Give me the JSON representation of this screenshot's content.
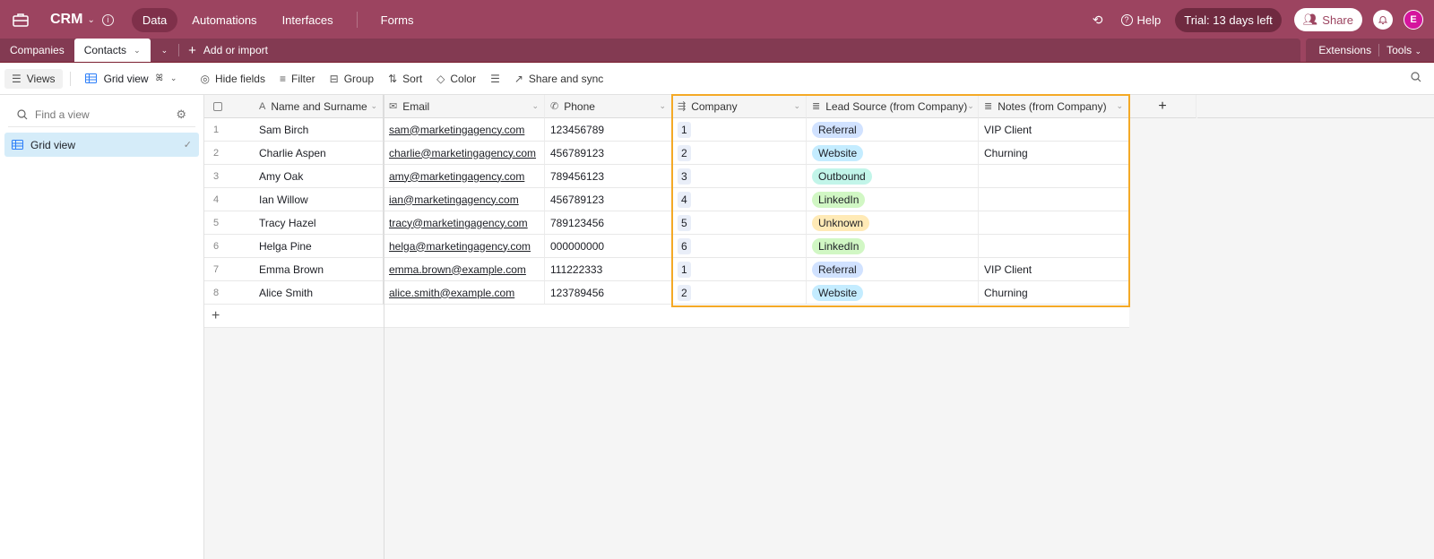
{
  "app": {
    "base_name": "CRM",
    "nav": [
      {
        "label": "Data",
        "active": true
      },
      {
        "label": "Automations",
        "active": false
      },
      {
        "label": "Interfaces",
        "active": false
      },
      {
        "label": "Forms",
        "active": false
      }
    ],
    "help_label": "Help",
    "trial_label": "Trial: 13 days left",
    "share_label": "Share",
    "avatar_initial": "E",
    "brand_color": "#9c4460"
  },
  "tables": {
    "tabs": [
      {
        "label": "Companies",
        "active": false
      },
      {
        "label": "Contacts",
        "active": true
      }
    ],
    "add_import_label": "Add or import",
    "extensions_label": "Extensions",
    "tools_label": "Tools"
  },
  "toolbar": {
    "views_label": "Views",
    "current_view": "Grid view",
    "hide_fields": "Hide fields",
    "filter": "Filter",
    "group": "Group",
    "sort": "Sort",
    "color": "Color",
    "share_sync": "Share and sync"
  },
  "sidebar": {
    "find_placeholder": "Find a view",
    "views": [
      {
        "label": "Grid view",
        "selected": true
      }
    ]
  },
  "grid": {
    "columns": [
      {
        "label": "Name and Surname",
        "icon": "text-icon"
      },
      {
        "label": "Email",
        "icon": "email-icon"
      },
      {
        "label": "Phone",
        "icon": "phone-icon"
      },
      {
        "label": "Company",
        "icon": "link-record-icon"
      },
      {
        "label": "Lead Source (from Company)",
        "icon": "lookup-icon"
      },
      {
        "label": "Notes (from Company)",
        "icon": "lookup-icon"
      }
    ],
    "add_column_label": "+",
    "add_row_label": "+",
    "rows": [
      {
        "num": "1",
        "name": "Sam Birch",
        "email": "sam@marketingagency.com",
        "phone": "123456789",
        "company": "1",
        "lead": "Referral",
        "notes": "VIP Client"
      },
      {
        "num": "2",
        "name": "Charlie Aspen",
        "email": "charlie@marketingagency.com",
        "phone": "456789123",
        "company": "2",
        "lead": "Website",
        "notes": "Churning"
      },
      {
        "num": "3",
        "name": "Amy Oak",
        "email": "amy@marketingagency.com",
        "phone": "789456123",
        "company": "3",
        "lead": "Outbound",
        "notes": ""
      },
      {
        "num": "4",
        "name": "Ian Willow",
        "email": "ian@marketingagency.com",
        "phone": "456789123",
        "company": "4",
        "lead": "LinkedIn",
        "notes": ""
      },
      {
        "num": "5",
        "name": "Tracy Hazel",
        "email": "tracy@marketingagency.com",
        "phone": "789123456",
        "company": "5",
        "lead": "Unknown",
        "notes": ""
      },
      {
        "num": "6",
        "name": "Helga Pine",
        "email": "helga@marketingagency.com",
        "phone": "000000000",
        "company": "6",
        "lead": "LinkedIn",
        "notes": ""
      },
      {
        "num": "7",
        "name": "Emma Brown",
        "email": "emma.brown@example.com",
        "phone": "111222333",
        "company": "1",
        "lead": "Referral",
        "notes": "VIP Client"
      },
      {
        "num": "8",
        "name": "Alice Smith",
        "email": "alice.smith@example.com",
        "phone": "123789456",
        "company": "2",
        "lead": "Website",
        "notes": "Churning"
      }
    ],
    "lead_colors": {
      "Referral": "#d1e2ff",
      "Website": "#c4ecff",
      "Outbound": "#c2f5e9",
      "LinkedIn": "#d1f7c4",
      "Unknown": "#ffeab6"
    },
    "highlight_color": "#f4a926"
  }
}
